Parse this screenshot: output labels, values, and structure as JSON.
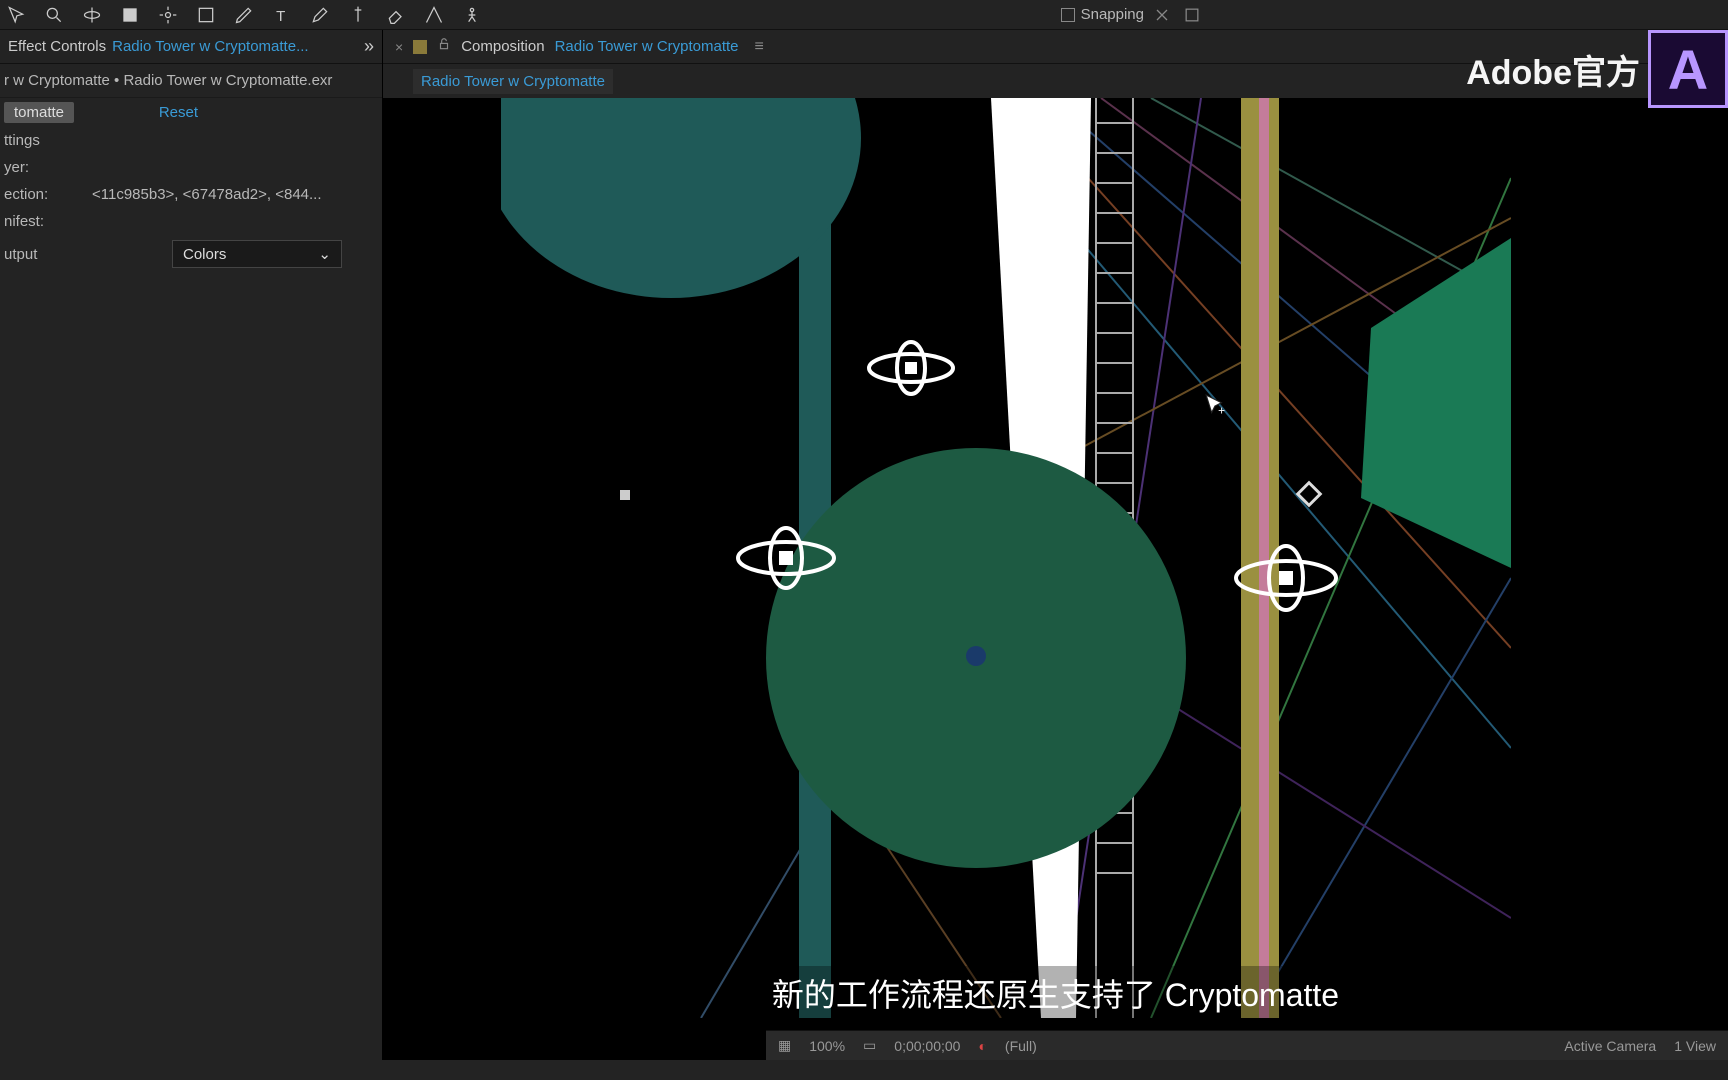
{
  "toolbar": {
    "snapping": "Snapping"
  },
  "effect_controls": {
    "panel_label": "Effect Controls",
    "panel_link": "Radio Tower w Cryptomatte...",
    "layer_path": "r w Cryptomatte • Radio Tower w Cryptomatte.exr",
    "effect_name": "tomatte",
    "reset": "Reset",
    "props": {
      "settings": "ttings",
      "layer": "yer:",
      "selection_k": "ection:",
      "selection_v": "<11c985b3>, <67478ad2>, <844...",
      "manifest": "nifest:",
      "output_k": "utput",
      "output_v": "Colors"
    }
  },
  "composition": {
    "panel_label": "Composition",
    "panel_link": "Radio Tower w Cryptomatte",
    "active_tab": "Radio Tower w Cryptomatte"
  },
  "viewer_footer": {
    "zoom": "100%",
    "timecode": "0;00;00;00",
    "res": "(Full)",
    "camera": "Active Camera",
    "views": "1 View"
  },
  "caption": "新的工作流程还原生支持了 Cryptomatte",
  "brand": {
    "text": "Adobe官方",
    "logo": "A"
  },
  "colors": {
    "teal": "#1f5a58",
    "green": "#1d5a42",
    "green2": "#1a7a55",
    "white": "#ffffff",
    "olive": "#9a9040",
    "pink": "#c47c9a"
  }
}
